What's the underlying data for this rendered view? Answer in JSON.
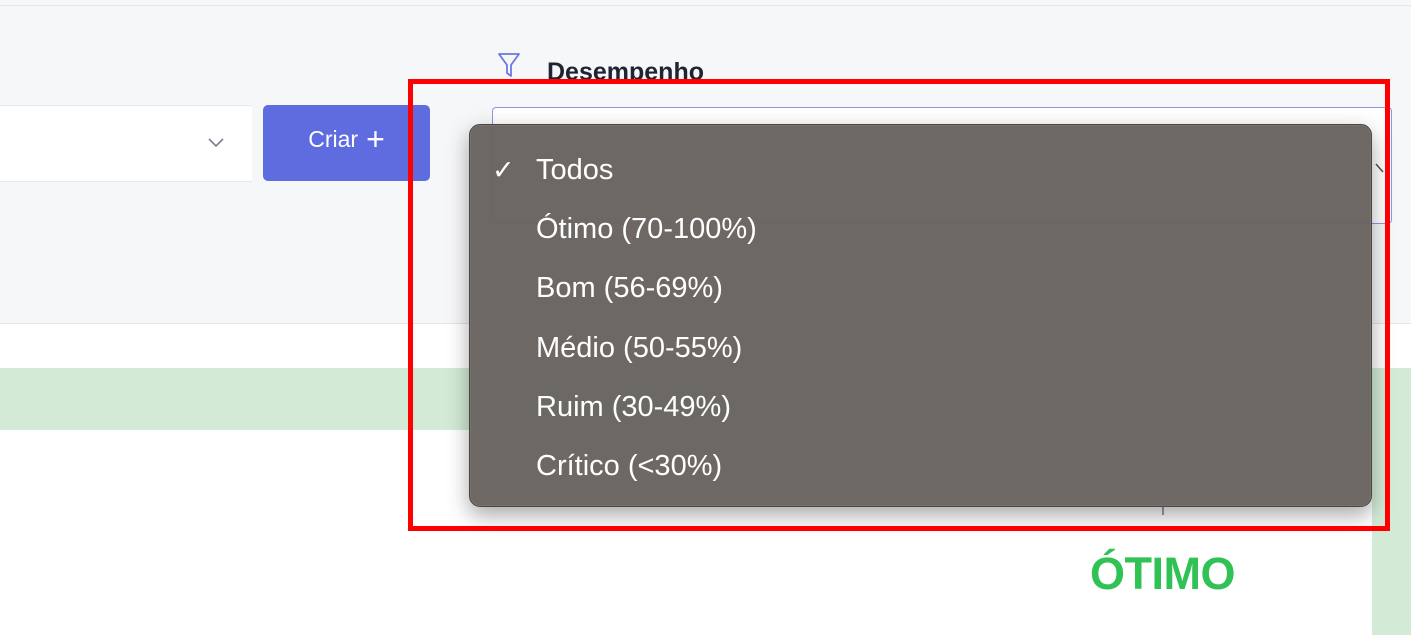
{
  "toolbar": {
    "create_label": "Criar",
    "create_icon": "plus-icon"
  },
  "filter": {
    "label": "Desempenho",
    "icon": "filter-icon",
    "dropdown": {
      "selected": "Todos",
      "options": [
        {
          "label": "Todos",
          "checked": true
        },
        {
          "label": "Ótimo (70-100%)",
          "checked": false
        },
        {
          "label": "Bom (56-69%)",
          "checked": false
        },
        {
          "label": "Médio (50-55%)",
          "checked": false
        },
        {
          "label": "Ruim (30-49%)",
          "checked": false
        },
        {
          "label": "Crítico (<30%)",
          "checked": false
        }
      ]
    }
  },
  "result": {
    "status": "ÓTIMO"
  },
  "colors": {
    "accent": "#5f6cdf",
    "success": "#31c255",
    "row_highlight": "#d3ebd6",
    "annotation": "#ff0000",
    "menu_bg": "#68635f"
  }
}
